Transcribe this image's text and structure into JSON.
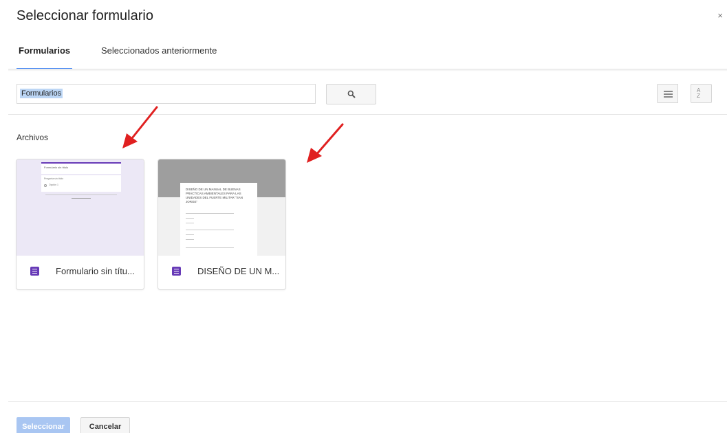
{
  "dialog": {
    "title": "Seleccionar formulario",
    "close_glyph": "×"
  },
  "tabs": [
    {
      "label": "Formularios",
      "active": true
    },
    {
      "label": "Seleccionados anteriormente",
      "active": false
    }
  ],
  "search": {
    "value": "Formularios",
    "icon": "search-icon"
  },
  "toolbar": {
    "list_view_icon": "list-view-icon",
    "sort_label_top": "A",
    "sort_label_bottom": "Z"
  },
  "section": {
    "label": "Archivos"
  },
  "files": [
    {
      "name": "Formulario sin títu...",
      "icon": "google-forms-icon",
      "thumbnail_color": "#ece8f6",
      "preview_title": "Formulario sin título",
      "preview_question": "Pregunta sin título",
      "preview_option": "Opción 1"
    },
    {
      "name": "DISEÑO DE UN M...",
      "icon": "google-forms-icon",
      "thumbnail_color": "#f1f1f1",
      "preview_title": "DISEÑO DE UN MANUAL DE BUENAS PRÁCTICAS AMBIENTALES PARA LAS UNIDADES DEL FUERTE MILITAR \"SAN JORGE\""
    }
  ],
  "footer": {
    "select_label": "Seleccionar",
    "cancel_label": "Cancelar"
  },
  "colors": {
    "accent": "#4285f4",
    "forms_purple": "#673ab7",
    "annotation_arrow": "#e02020",
    "select_disabled": "#a9c6f2"
  }
}
